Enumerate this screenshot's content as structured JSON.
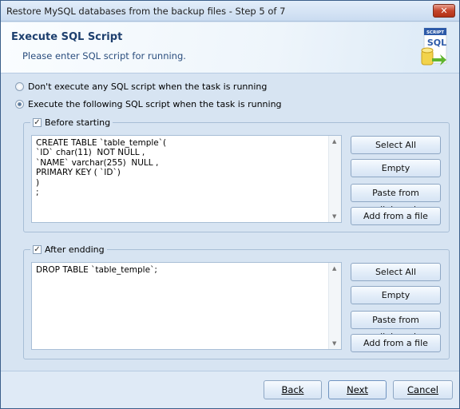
{
  "window": {
    "title": "Restore MySQL databases from the backup files - Step 5 of 7",
    "close_glyph": "✕"
  },
  "header": {
    "title": "Execute SQL Script",
    "subtitle": "Please enter SQL script for running.",
    "logo_text": "SCRIPT",
    "logo_sql": "SQL"
  },
  "options": [
    {
      "label": "Don't execute any SQL script when the task is running",
      "selected": false
    },
    {
      "label": "Execute the following SQL script when the task is running",
      "selected": true
    }
  ],
  "before": {
    "label": "Before starting",
    "checked": true,
    "script": "CREATE TABLE `table_temple`(\n`ID` char(11)  NOT NULL ,\n`NAME` varchar(255)  NULL ,\nPRIMARY KEY ( `ID`)\n)\n;"
  },
  "after": {
    "label": "After endding",
    "checked": true,
    "script": "DROP TABLE `table_temple`;"
  },
  "buttons": {
    "select_all": "Select All",
    "empty": "Empty",
    "paste": "Paste from clipboard",
    "add_file": "Add from a file"
  },
  "footer": {
    "back": "Back",
    "next": "Next",
    "cancel": "Cancel"
  }
}
